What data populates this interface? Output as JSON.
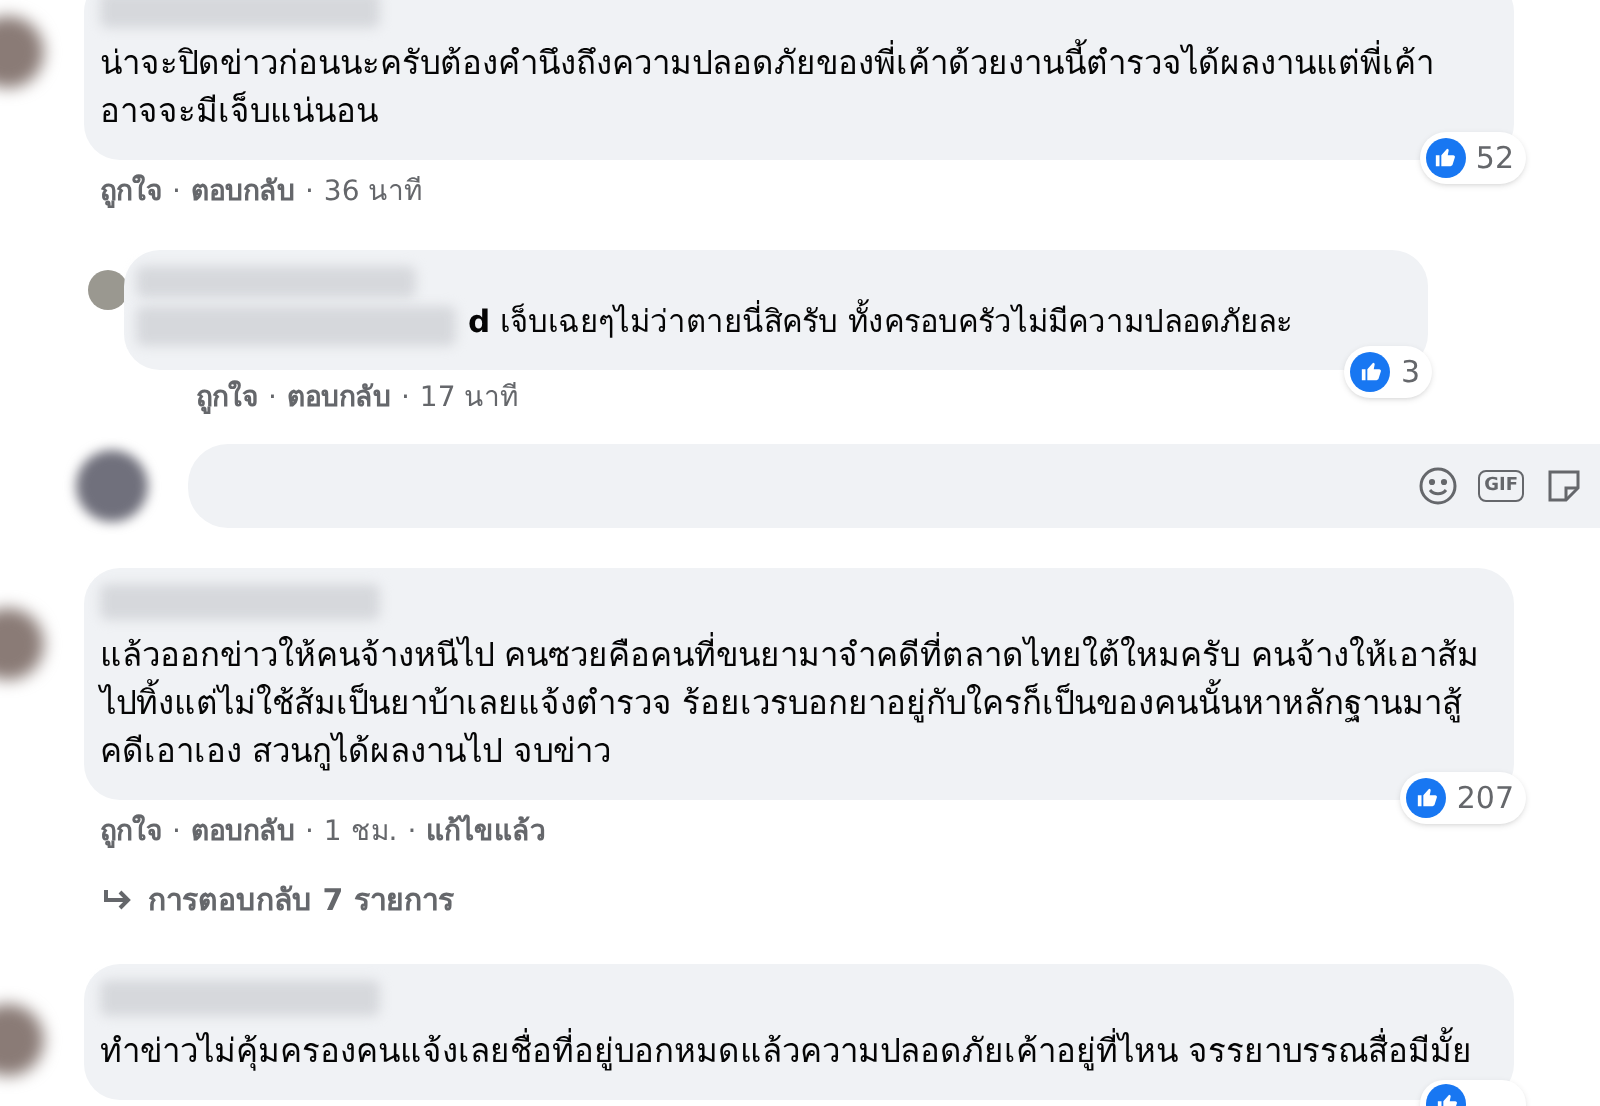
{
  "items": [
    {
      "kind": "comment",
      "text": "น่าจะปิดข่าวก่อนนะครับต้องคำนึงถึงความปลอดภัยของพี่เค้าด้วยงานนี้ตำรวจได้ผลงานแต่พี่เค้าอาจจะมีเจ็บแน่นอน",
      "likes": "52",
      "meta": [
        {
          "text": "ถูกใจ",
          "kind": "link"
        },
        {
          "text": "·",
          "kind": "sep"
        },
        {
          "text": "ตอบกลับ",
          "kind": "link"
        },
        {
          "text": "·",
          "kind": "sep"
        },
        {
          "text": "36 นาที",
          "kind": "time"
        }
      ]
    },
    {
      "kind": "reply",
      "name_fragment": "d",
      "text": "เจ็บเฉยๆไม่ว่าตายนี่สิครับ ทั้งครอบครัวไม่มีความปลอดภัยละ",
      "likes": "3",
      "meta": [
        {
          "text": "ถูกใจ",
          "kind": "link"
        },
        {
          "text": "·",
          "kind": "sep"
        },
        {
          "text": "ตอบกลับ",
          "kind": "link"
        },
        {
          "text": "·",
          "kind": "sep"
        },
        {
          "text": "17 นาที",
          "kind": "time"
        }
      ]
    },
    {
      "kind": "composer",
      "gif_label": "GIF"
    },
    {
      "kind": "comment",
      "text": "แล้วออกข่าวให้คนจ้างหนีไป คนซวยคือคนที่ขนยามาจำคดีที่ตลาดไทยใต้ใหมครับ คนจ้างให้เอาส้มไปทิ้งแต่ไม่ใช้ส้มเป็นยาบ้าเลยแจ้งตำรวจ ร้อยเวรบอกยาอยู่กับใครก็เป็นของคนนั้นหาหลักฐานมาสู้คดีเอาเอง สวนกูได้ผลงานไป จบข่าว",
      "likes": "207",
      "meta": [
        {
          "text": "ถูกใจ",
          "kind": "link"
        },
        {
          "text": "·",
          "kind": "sep"
        },
        {
          "text": "ตอบกลับ",
          "kind": "link"
        },
        {
          "text": "·",
          "kind": "sep"
        },
        {
          "text": "1 ชม.",
          "kind": "time"
        },
        {
          "text": "·",
          "kind": "sep"
        },
        {
          "text": "แก้ไขแล้ว",
          "kind": "link"
        }
      ],
      "replies_link": "การตอบกลับ 7 รายการ"
    },
    {
      "kind": "comment",
      "text": "ทำข่าวไม่คุ้มครองคนแจ้งเลยชื่อที่อยู่บอกหมดแล้วความปลอดภัยเค้าอยู่ที่ไหน จรรยาบรรณสื่อมีมั้ย",
      "like_badge_cut": true
    }
  ]
}
